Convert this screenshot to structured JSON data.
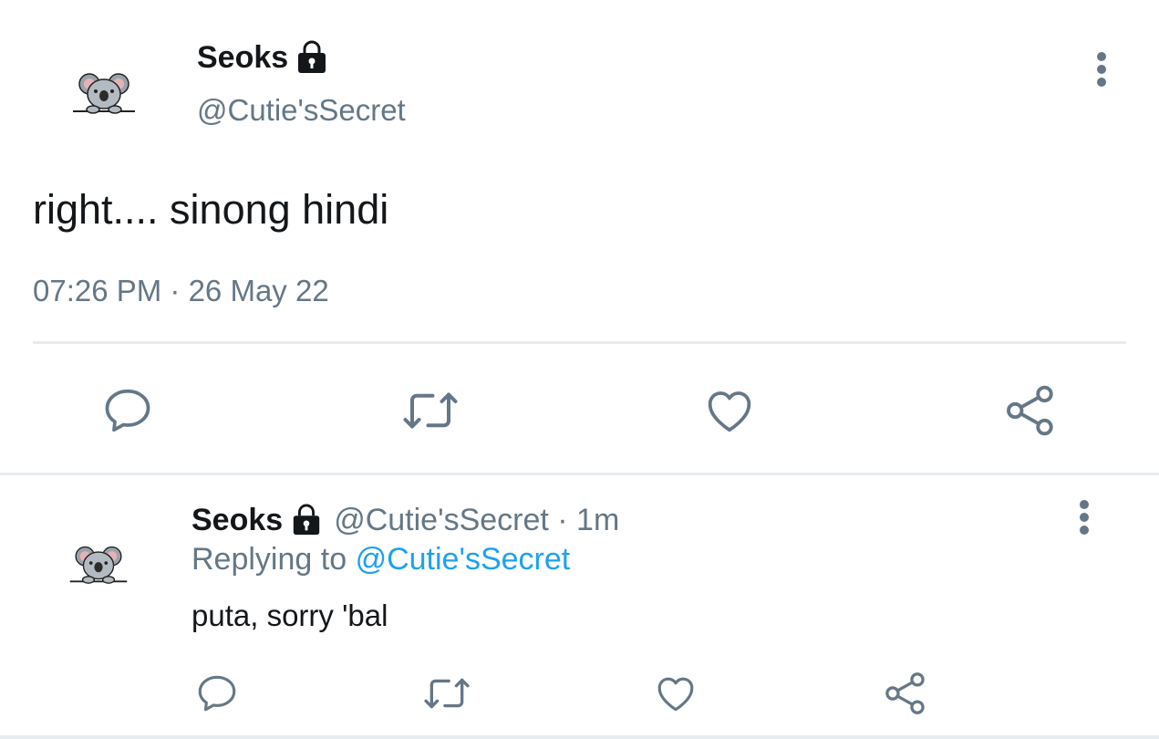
{
  "main_tweet": {
    "display_name": "Seoks",
    "handle": "@Cutie'sSecret",
    "text": "right.... sinong hindi",
    "timestamp": "07:26 PM · 26 May 22",
    "icons": {
      "avatar": "koala-avatar-icon",
      "lock": "lock-icon",
      "more": "more-vertical-icon",
      "reply": "reply-icon",
      "retweet": "retweet-icon",
      "like": "heart-icon",
      "share": "share-icon"
    }
  },
  "reply_tweet": {
    "display_name": "Seoks",
    "handle_time": "@Cutie'sSecret · 1m",
    "replying_prefix": "Replying to",
    "replying_to": "@Cutie'sSecret",
    "text": "puta, sorry 'bal"
  },
  "colors": {
    "text": "#14171a",
    "secondary": "#657786",
    "link": "#1da1f2",
    "divider": "#e6ecf0"
  }
}
